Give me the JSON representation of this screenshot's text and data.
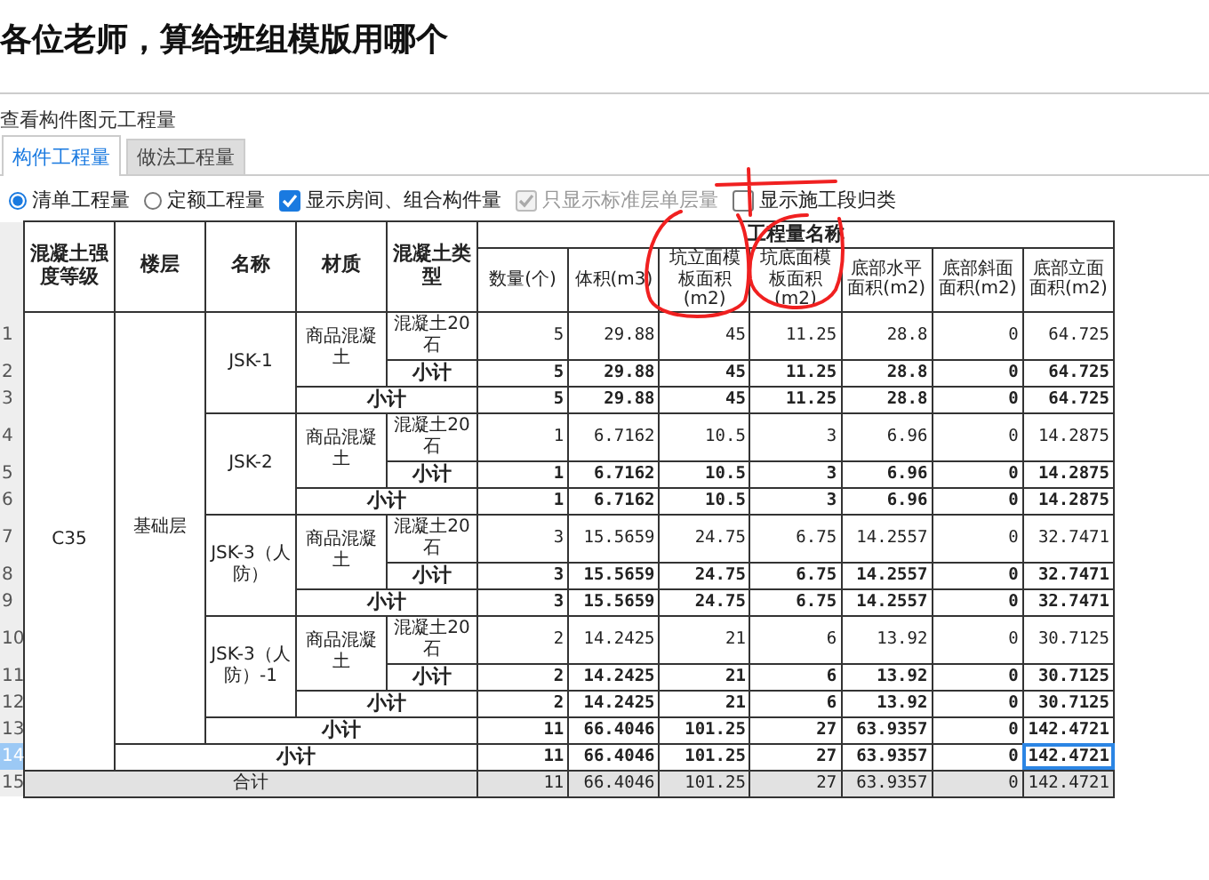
{
  "post_title": "各位老师，算给班组模版用哪个",
  "panel": {
    "title": "查看构件图元工程量",
    "tabs": [
      {
        "label": "构件工程量",
        "selected": true
      },
      {
        "label": "做法工程量",
        "selected": false
      }
    ],
    "options": [
      {
        "kind": "radio",
        "label": "清单工程量",
        "checked": true,
        "disabled": false
      },
      {
        "kind": "radio",
        "label": "定额工程量",
        "checked": false,
        "disabled": false
      },
      {
        "kind": "checkbox",
        "label": "显示房间、组合构件量",
        "checked": true,
        "disabled": false
      },
      {
        "kind": "checkbox",
        "label": "只显示标准层单层量",
        "checked": true,
        "disabled": true
      },
      {
        "kind": "checkbox",
        "label": "显示施工段归类",
        "checked": false,
        "disabled": false
      }
    ],
    "table": {
      "fixed_columns": [
        "混凝土强度等级",
        "楼层",
        "名称",
        "材质",
        "混凝土类型"
      ],
      "group": {
        "title": "工程量名称",
        "columns": [
          "数量(个)",
          "体积(m3)",
          "坑立面模板面积(m2)",
          "坑底面模板面积(m2)",
          "底部水平面积(m2)",
          "底部斜面面积(m2)",
          "底部立面面积(m2)"
        ]
      },
      "rows": [
        {
          "number": "1",
          "kind": "item",
          "selected": false,
          "labels": [
            {
              "text": "C35",
              "rowspan": 14
            },
            {
              "text": "基础层",
              "rowspan": 13
            },
            {
              "text": "JSK-1",
              "rowspan": 3
            },
            {
              "text": "商品混凝土",
              "rowspan": 2
            },
            {
              "text": "混凝土20石"
            }
          ],
          "values": [
            "5",
            "29.88",
            "45",
            "11.25",
            "28.8",
            "0",
            "64.725"
          ]
        },
        {
          "number": "2",
          "kind": "subtotal",
          "selected": false,
          "labels": [
            {
              "text": "小计"
            }
          ],
          "values": [
            "5",
            "29.88",
            "45",
            "11.25",
            "28.8",
            "0",
            "64.725"
          ]
        },
        {
          "number": "3",
          "kind": "subtotal",
          "selected": false,
          "labels": [
            {
              "text": "小计",
              "colspan": 2
            }
          ],
          "values": [
            "5",
            "29.88",
            "45",
            "11.25",
            "28.8",
            "0",
            "64.725"
          ]
        },
        {
          "number": "4",
          "kind": "item",
          "selected": false,
          "labels": [
            {
              "text": "JSK-2",
              "rowspan": 3
            },
            {
              "text": "商品混凝土",
              "rowspan": 2
            },
            {
              "text": "混凝土20石"
            }
          ],
          "values": [
            "1",
            "6.7162",
            "10.5",
            "3",
            "6.96",
            "0",
            "14.2875"
          ]
        },
        {
          "number": "5",
          "kind": "subtotal",
          "selected": false,
          "labels": [
            {
              "text": "小计"
            }
          ],
          "values": [
            "1",
            "6.7162",
            "10.5",
            "3",
            "6.96",
            "0",
            "14.2875"
          ]
        },
        {
          "number": "6",
          "kind": "subtotal",
          "selected": false,
          "labels": [
            {
              "text": "小计",
              "colspan": 2
            }
          ],
          "values": [
            "1",
            "6.7162",
            "10.5",
            "3",
            "6.96",
            "0",
            "14.2875"
          ]
        },
        {
          "number": "7",
          "kind": "item",
          "selected": false,
          "labels": [
            {
              "text": "JSK-3（人防）",
              "rowspan": 3
            },
            {
              "text": "商品混凝土",
              "rowspan": 2
            },
            {
              "text": "混凝土20石"
            }
          ],
          "values": [
            "3",
            "15.5659",
            "24.75",
            "6.75",
            "14.2557",
            "0",
            "32.7471"
          ]
        },
        {
          "number": "8",
          "kind": "subtotal",
          "selected": false,
          "labels": [
            {
              "text": "小计"
            }
          ],
          "values": [
            "3",
            "15.5659",
            "24.75",
            "6.75",
            "14.2557",
            "0",
            "32.7471"
          ]
        },
        {
          "number": "9",
          "kind": "subtotal",
          "selected": false,
          "labels": [
            {
              "text": "小计",
              "colspan": 2
            }
          ],
          "values": [
            "3",
            "15.5659",
            "24.75",
            "6.75",
            "14.2557",
            "0",
            "32.7471"
          ]
        },
        {
          "number": "10",
          "kind": "item",
          "selected": false,
          "labels": [
            {
              "text": "JSK-3（人防）-1",
              "rowspan": 3
            },
            {
              "text": "商品混凝土",
              "rowspan": 2
            },
            {
              "text": "混凝土20石"
            }
          ],
          "values": [
            "2",
            "14.2425",
            "21",
            "6",
            "13.92",
            "0",
            "30.7125"
          ]
        },
        {
          "number": "11",
          "kind": "subtotal",
          "selected": false,
          "labels": [
            {
              "text": "小计"
            }
          ],
          "values": [
            "2",
            "14.2425",
            "21",
            "6",
            "13.92",
            "0",
            "30.7125"
          ]
        },
        {
          "number": "12",
          "kind": "subtotal",
          "selected": false,
          "labels": [
            {
              "text": "小计",
              "colspan": 2
            }
          ],
          "values": [
            "2",
            "14.2425",
            "21",
            "6",
            "13.92",
            "0",
            "30.7125"
          ]
        },
        {
          "number": "13",
          "kind": "subtotal",
          "selected": false,
          "labels": [
            {
              "text": "小计",
              "colspan": 3
            }
          ],
          "values": [
            "11",
            "66.4046",
            "101.25",
            "27",
            "63.9357",
            "0",
            "142.4721"
          ]
        },
        {
          "number": "14",
          "kind": "subtotal",
          "selected": true,
          "labels": [
            {
              "text": "小计",
              "colspan": 4
            }
          ],
          "values": [
            "11",
            "66.4046",
            "101.25",
            "27",
            "63.9357",
            "0",
            "142.4721"
          ]
        },
        {
          "number": "15",
          "kind": "total",
          "selected": false,
          "labels": [
            {
              "text": "合计",
              "colspan": 5
            }
          ],
          "values": [
            "11",
            "66.4046",
            "101.25",
            "27",
            "63.9357",
            "0",
            "142.4721"
          ]
        }
      ]
    }
  }
}
